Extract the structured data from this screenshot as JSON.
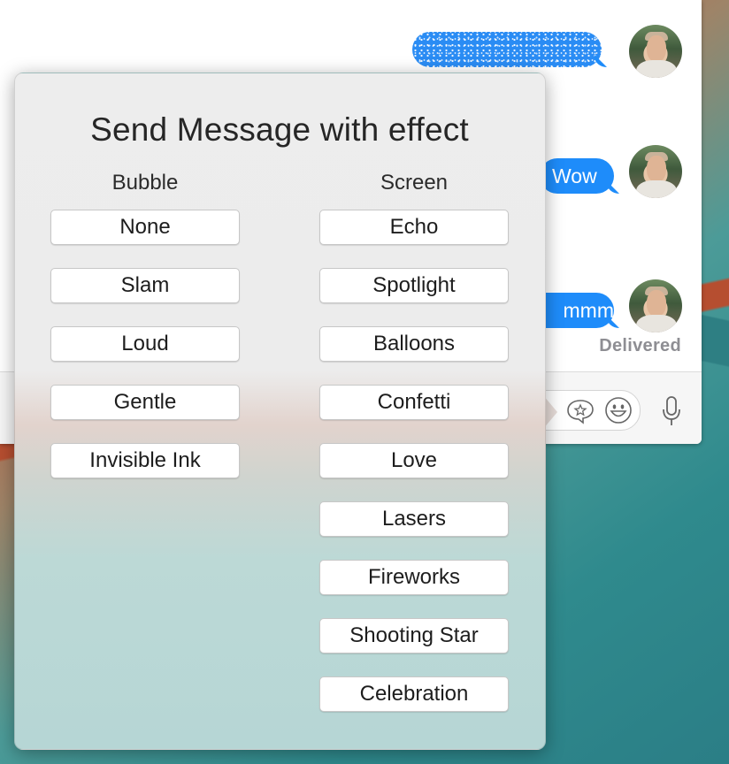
{
  "conversation": {
    "messages": [
      {
        "text": "",
        "effect": "invisible-ink"
      },
      {
        "text": "Wow"
      },
      {
        "text": "mmm"
      }
    ],
    "status": "Delivered"
  },
  "popover": {
    "title": "Send Message with effect",
    "bubble_header": "Bubble",
    "screen_header": "Screen",
    "bubble_effects": [
      "None",
      "Slam",
      "Loud",
      "Gentle",
      "Invisible Ink"
    ],
    "screen_effects": [
      "Echo",
      "Spotlight",
      "Balloons",
      "Confetti",
      "Love",
      "Lasers",
      "Fireworks",
      "Shooting Star",
      "Celebration"
    ]
  },
  "icons": [
    "avatar",
    "digital-touch-icon",
    "emoji-icon",
    "microphone-icon"
  ],
  "colors": {
    "bubble_blue": "#1e8cfa",
    "delivered_gray": "#8e8e93"
  }
}
